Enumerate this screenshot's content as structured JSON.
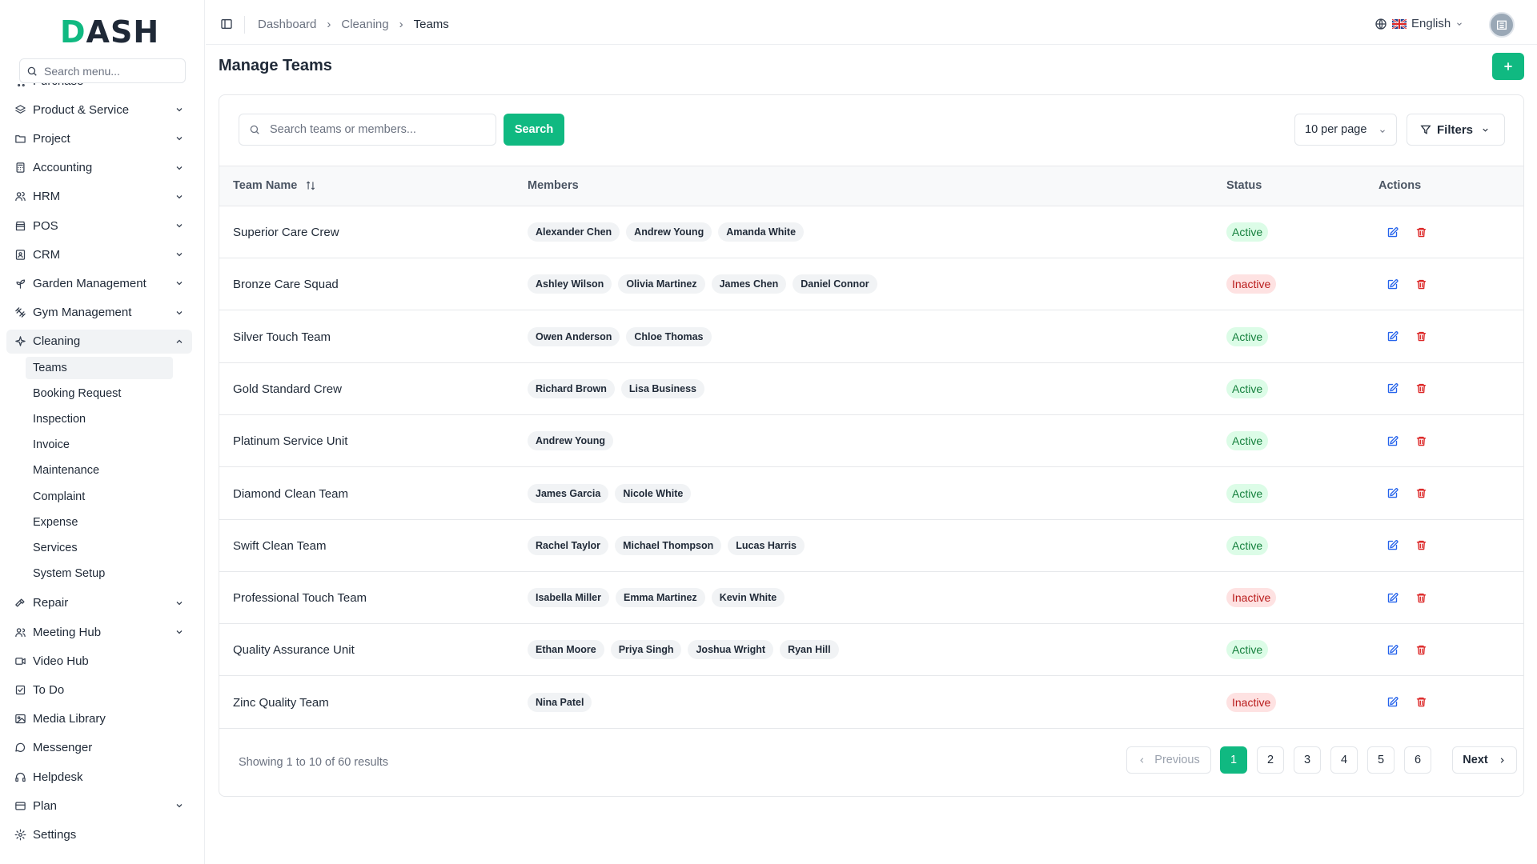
{
  "app": {
    "logo_prefix": "D",
    "logo_rest": "ASH"
  },
  "sidebar": {
    "search_placeholder": "Search menu...",
    "items": [
      {
        "label": "Purchase",
        "icon": "cart-icon",
        "expandable": true
      },
      {
        "label": "Product & Service",
        "icon": "layers-icon",
        "expandable": true
      },
      {
        "label": "Project",
        "icon": "folder-icon",
        "expandable": true
      },
      {
        "label": "Accounting",
        "icon": "calculator-icon",
        "expandable": true
      },
      {
        "label": "HRM",
        "icon": "users-icon",
        "expandable": true
      },
      {
        "label": "POS",
        "icon": "store-icon",
        "expandable": true
      },
      {
        "label": "CRM",
        "icon": "contact-icon",
        "expandable": true
      },
      {
        "label": "Garden Management",
        "icon": "plant-icon",
        "expandable": true
      },
      {
        "label": "Gym Management",
        "icon": "dumbbell-icon",
        "expandable": true
      },
      {
        "label": "Cleaning",
        "icon": "sparkle-icon",
        "expandable": true,
        "expanded": true
      },
      {
        "label": "Repair",
        "icon": "hammer-icon",
        "expandable": true
      },
      {
        "label": "Meeting Hub",
        "icon": "people-icon",
        "expandable": true
      },
      {
        "label": "Video Hub",
        "icon": "video-icon",
        "expandable": false
      },
      {
        "label": "To Do",
        "icon": "checkbox-icon",
        "expandable": false
      },
      {
        "label": "Media Library",
        "icon": "image-icon",
        "expandable": false
      },
      {
        "label": "Messenger",
        "icon": "chat-icon",
        "expandable": false
      },
      {
        "label": "Helpdesk",
        "icon": "headset-icon",
        "expandable": false
      },
      {
        "label": "Plan",
        "icon": "card-icon",
        "expandable": true
      },
      {
        "label": "Settings",
        "icon": "gear-icon",
        "expandable": false
      }
    ],
    "cleaning_sub": [
      "Teams",
      "Booking Request",
      "Inspection",
      "Invoice",
      "Maintenance",
      "Complaint",
      "Expense",
      "Services",
      "System Setup"
    ]
  },
  "header": {
    "breadcrumb": [
      "Dashboard",
      "Cleaning",
      "Teams"
    ],
    "language": "English"
  },
  "main": {
    "title": "Manage Teams",
    "search_placeholder": "Search teams or members...",
    "search_button": "Search",
    "per_page": "10 per page",
    "filters": "Filters",
    "columns": {
      "name": "Team Name",
      "members": "Members",
      "status": "Status",
      "actions": "Actions"
    },
    "rows": [
      {
        "name": "Superior Care Crew",
        "members": [
          "Alexander Chen",
          "Andrew Young",
          "Amanda White"
        ],
        "status": "Active"
      },
      {
        "name": "Bronze Care Squad",
        "members": [
          "Ashley Wilson",
          "Olivia Martinez",
          "James Chen",
          "Daniel Connor"
        ],
        "status": "Inactive"
      },
      {
        "name": "Silver Touch Team",
        "members": [
          "Owen Anderson",
          "Chloe Thomas"
        ],
        "status": "Active"
      },
      {
        "name": "Gold Standard Crew",
        "members": [
          "Richard Brown",
          "Lisa Business"
        ],
        "status": "Active"
      },
      {
        "name": "Platinum Service Unit",
        "members": [
          "Andrew Young"
        ],
        "status": "Active"
      },
      {
        "name": "Diamond Clean Team",
        "members": [
          "James Garcia",
          "Nicole White"
        ],
        "status": "Active"
      },
      {
        "name": "Swift Clean Team",
        "members": [
          "Rachel Taylor",
          "Michael Thompson",
          "Lucas Harris"
        ],
        "status": "Active"
      },
      {
        "name": "Professional Touch Team",
        "members": [
          "Isabella Miller",
          "Emma Martinez",
          "Kevin White"
        ],
        "status": "Inactive"
      },
      {
        "name": "Quality Assurance Unit",
        "members": [
          "Ethan Moore",
          "Priya Singh",
          "Joshua Wright",
          "Ryan Hill"
        ],
        "status": "Active"
      },
      {
        "name": "Zinc Quality Team",
        "members": [
          "Nina Patel"
        ],
        "status": "Inactive"
      }
    ],
    "footer": "Showing 1 to 10 of 60 results",
    "pagination": {
      "previous": "Previous",
      "next": "Next",
      "pages": [
        "1",
        "2",
        "3",
        "4",
        "5",
        "6"
      ],
      "current": "1"
    }
  },
  "colors": {
    "accent": "#10b981",
    "active_bg": "#dcfce7",
    "active_fg": "#15803d",
    "inactive_bg": "#fee2e2",
    "inactive_fg": "#b91c1c",
    "edit": "#2563eb",
    "delete": "#dc2626"
  }
}
